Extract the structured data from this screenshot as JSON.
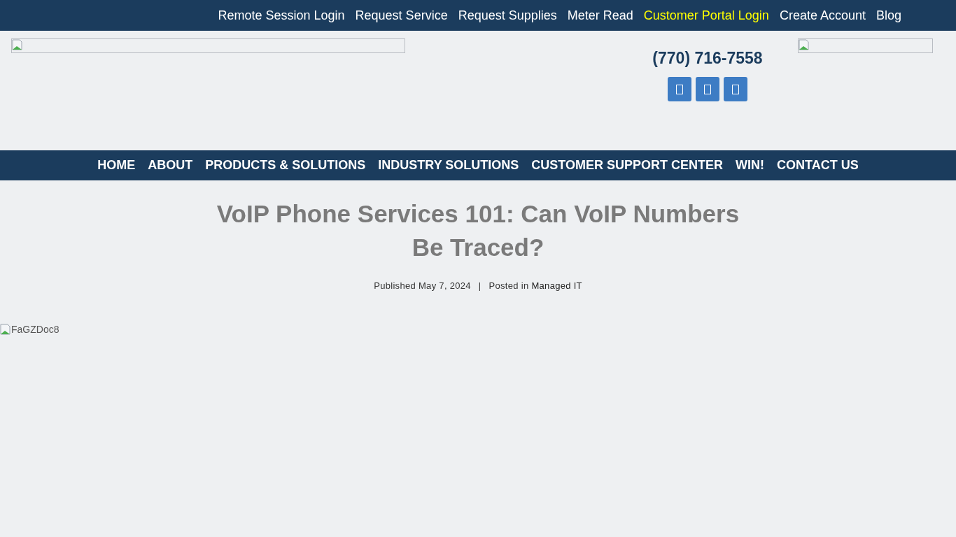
{
  "top_links": [
    {
      "label": "Remote Session Login",
      "highlighted": false
    },
    {
      "label": "Request Service",
      "highlighted": false
    },
    {
      "label": "Request Supplies",
      "highlighted": false
    },
    {
      "label": "Meter Read",
      "highlighted": false
    },
    {
      "label": "Customer Portal Login",
      "highlighted": true
    },
    {
      "label": "Create Account",
      "highlighted": false
    },
    {
      "label": "Blog",
      "highlighted": false
    }
  ],
  "header": {
    "phone": "(770) 716-7558",
    "social_buttons": [
      {
        "kind": "icon"
      },
      {
        "kind": "icon"
      },
      {
        "kind": "icon"
      }
    ]
  },
  "nav": [
    "HOME",
    "ABOUT",
    "PRODUCTS & SOLUTIONS",
    "INDUSTRY SOLUTIONS",
    "CUSTOMER SUPPORT CENTER",
    "WIN!",
    "CONTACT US"
  ],
  "article": {
    "title": "VoIP Phone Services 101: Can VoIP Numbers Be Traced?",
    "published_label": "Published",
    "date": "May 7, 2024",
    "separator": "|",
    "posted_label": "Posted in",
    "category": "Managed IT",
    "image_alt": "FaGZDoc8"
  }
}
